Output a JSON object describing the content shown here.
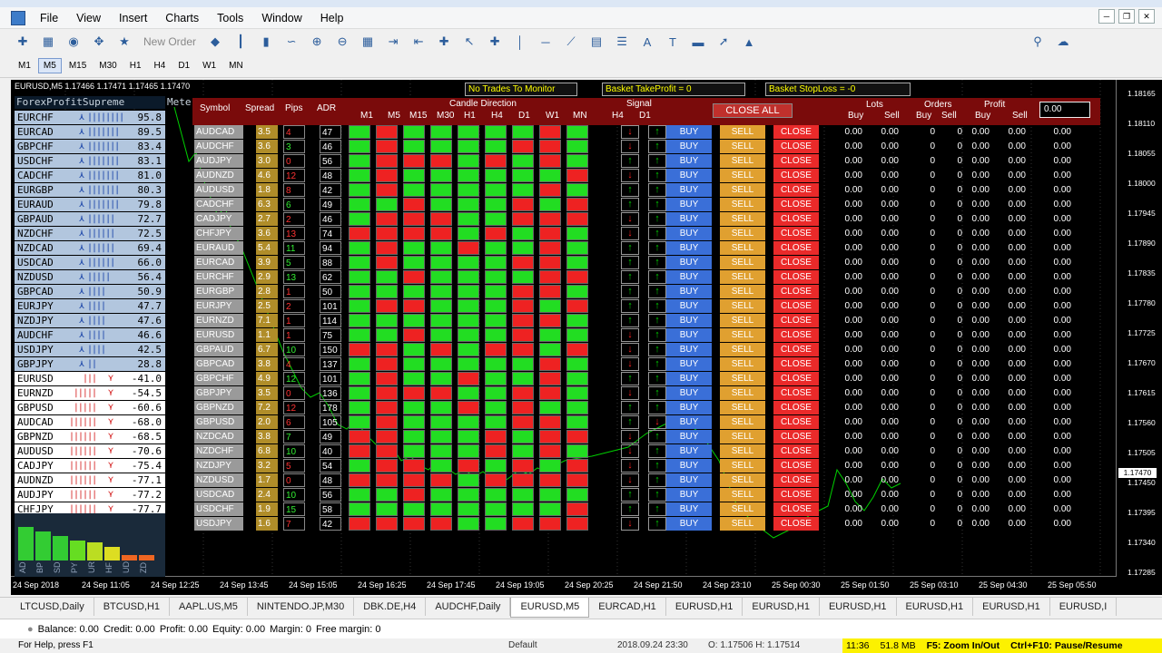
{
  "menu": [
    "File",
    "View",
    "Insert",
    "Charts",
    "Tools",
    "Window",
    "Help"
  ],
  "toolbar": {
    "new_order": "New Order"
  },
  "timeframes": [
    "M1",
    "M5",
    "M15",
    "M30",
    "H1",
    "H4",
    "D1",
    "W1",
    "MN"
  ],
  "active_timeframe": "M5",
  "chart": {
    "symbol_line": "EURUSD,M5  1.17466 1.17471 1.17465 1.17470",
    "current_price": "1.17470",
    "y_ticks": [
      "1.18165",
      "1.18110",
      "1.18055",
      "1.18000",
      "1.17945",
      "1.17890",
      "1.17835",
      "1.17780",
      "1.17725",
      "1.17670",
      "1.17615",
      "1.17560",
      "1.17505",
      "1.17450",
      "1.17395",
      "1.17340",
      "1.17285"
    ],
    "x_ticks": [
      "24 Sep 2018",
      "24 Sep 11:05",
      "24 Sep 12:25",
      "24 Sep 13:45",
      "24 Sep 15:05",
      "24 Sep 16:25",
      "24 Sep 17:45",
      "24 Sep 19:05",
      "24 Sep 20:25",
      "24 Sep 21:50",
      "24 Sep 23:10",
      "25 Sep 00:30",
      "25 Sep 01:50",
      "25 Sep 03:10",
      "25 Sep 04:30",
      "25 Sep 05:50"
    ]
  },
  "meter": {
    "title": "ForexProfitSupreme",
    "title2": "Meter",
    "rows": [
      {
        "pair": "EURCHF",
        "dir": "up",
        "value": "95.8"
      },
      {
        "pair": "EURCAD",
        "dir": "up",
        "value": "89.5"
      },
      {
        "pair": "GBPCHF",
        "dir": "up",
        "value": "83.4"
      },
      {
        "pair": "USDCHF",
        "dir": "up",
        "value": "83.1"
      },
      {
        "pair": "CADCHF",
        "dir": "up",
        "value": "81.0"
      },
      {
        "pair": "EURGBP",
        "dir": "up",
        "value": "80.3"
      },
      {
        "pair": "EURAUD",
        "dir": "up",
        "value": "79.8"
      },
      {
        "pair": "GBPAUD",
        "dir": "up",
        "value": "72.7"
      },
      {
        "pair": "NZDCHF",
        "dir": "up",
        "value": "72.5"
      },
      {
        "pair": "NZDCAD",
        "dir": "up",
        "value": "69.4"
      },
      {
        "pair": "USDCAD",
        "dir": "up",
        "value": "66.0"
      },
      {
        "pair": "NZDUSD",
        "dir": "up",
        "value": "56.4"
      },
      {
        "pair": "GBPCAD",
        "dir": "up",
        "value": "50.9"
      },
      {
        "pair": "EURJPY",
        "dir": "up",
        "value": "47.7"
      },
      {
        "pair": "NZDJPY",
        "dir": "up",
        "value": "47.6"
      },
      {
        "pair": "AUDCHF",
        "dir": "up",
        "value": "46.6"
      },
      {
        "pair": "USDJPY",
        "dir": "up",
        "value": "42.5"
      },
      {
        "pair": "GBPJPY",
        "dir": "up",
        "value": "28.8"
      },
      {
        "pair": "EURUSD",
        "dir": "dn",
        "value": "-41.0"
      },
      {
        "pair": "EURNZD",
        "dir": "dn",
        "value": "-54.5"
      },
      {
        "pair": "GBPUSD",
        "dir": "dn",
        "value": "-60.6"
      },
      {
        "pair": "AUDCAD",
        "dir": "dn",
        "value": "-68.0"
      },
      {
        "pair": "GBPNZD",
        "dir": "dn",
        "value": "-68.5"
      },
      {
        "pair": "AUDUSD",
        "dir": "dn",
        "value": "-70.6"
      },
      {
        "pair": "CADJPY",
        "dir": "dn",
        "value": "-75.4"
      },
      {
        "pair": "AUDNZD",
        "dir": "dn",
        "value": "-77.1"
      },
      {
        "pair": "AUDJPY",
        "dir": "dn",
        "value": "-77.2"
      },
      {
        "pair": "CHFJPY",
        "dir": "dn",
        "value": "-77.7"
      }
    ],
    "currencies": [
      "AD",
      "BP",
      "SD",
      "PY",
      "UR",
      "HF",
      "UD",
      "ZD"
    ],
    "currency_levels": [
      0.75,
      0.65,
      0.55,
      0.45,
      0.4,
      0.3,
      0.12,
      0.12
    ]
  },
  "dashboard": {
    "tickers": {
      "no_trades": "No Trades To Monitor",
      "basket_tp": "Basket TakeProfit = 0",
      "basket_sl": "Basket StopLoss = -0"
    },
    "close_all": "CLOSE ALL",
    "input_value": "0.00",
    "headers": {
      "symbol": "Symbol",
      "spread": "Spread",
      "pips": "Pips",
      "adr": "ADR",
      "candle": "Candle Direction",
      "signal": "Signal",
      "lots": "Lots",
      "orders": "Orders",
      "profit": "Profit",
      "buy": "Buy",
      "sell": "Sell"
    },
    "buy_label": "BUY",
    "sell_label": "SELL",
    "close_label": "CLOSE",
    "zero": "0.00",
    "zero_int": "0",
    "rows": [
      {
        "sym": "AUDCAD",
        "spread": "3.5",
        "pips": "4",
        "adr": "47",
        "pips_color": "r",
        "cd": "grgggggrgg",
        "h4": "d",
        "d1": "u"
      },
      {
        "sym": "AUDCHF",
        "spread": "3.6",
        "pips": "3",
        "adr": "46",
        "pips_color": "g",
        "cd": "grggggrrgg",
        "h4": "d",
        "d1": "u"
      },
      {
        "sym": "AUDJPY",
        "spread": "3.0",
        "pips": "0",
        "adr": "56",
        "pips_color": "r",
        "cd": "grrrgrgrgg",
        "h4": "u",
        "d1": "u"
      },
      {
        "sym": "AUDNZD",
        "spread": "4.6",
        "pips": "12",
        "adr": "48",
        "pips_color": "r",
        "cd": "grggggggrg",
        "h4": "d",
        "d1": "u"
      },
      {
        "sym": "AUDUSD",
        "spread": "1.8",
        "pips": "8",
        "adr": "42",
        "pips_color": "r",
        "cd": "grgggggrgg",
        "h4": "u",
        "d1": "u"
      },
      {
        "sym": "CADCHF",
        "spread": "6.3",
        "pips": "6",
        "adr": "49",
        "pips_color": "g",
        "cd": "ggrgggrgrg",
        "h4": "u",
        "d1": "u"
      },
      {
        "sym": "CADJPY",
        "spread": "2.7",
        "pips": "2",
        "adr": "46",
        "pips_color": "r",
        "cd": "grrrggrrrg",
        "h4": "d",
        "d1": "u"
      },
      {
        "sym": "CHFJPY",
        "spread": "3.6",
        "pips": "13",
        "adr": "74",
        "pips_color": "r",
        "cd": "rrrrgrgrgg",
        "h4": "d",
        "d1": "u"
      },
      {
        "sym": "EURAUD",
        "spread": "5.4",
        "pips": "11",
        "adr": "94",
        "pips_color": "g",
        "cd": "grggrggrgg",
        "h4": "u",
        "d1": "u"
      },
      {
        "sym": "EURCAD",
        "spread": "3.9",
        "pips": "5",
        "adr": "88",
        "pips_color": "g",
        "cd": "grggggrrgg",
        "h4": "u",
        "d1": "u"
      },
      {
        "sym": "EURCHF",
        "spread": "2.9",
        "pips": "13",
        "adr": "62",
        "pips_color": "g",
        "cd": "ggrggggrrg",
        "h4": "u",
        "d1": "u"
      },
      {
        "sym": "EURGBP",
        "spread": "2.8",
        "pips": "1",
        "adr": "50",
        "pips_color": "r",
        "cd": "ggggggrrgg",
        "h4": "u",
        "d1": "u"
      },
      {
        "sym": "EURJPY",
        "spread": "2.5",
        "pips": "2",
        "adr": "101",
        "pips_color": "r",
        "cd": "grrgggrgrg",
        "h4": "u",
        "d1": "u"
      },
      {
        "sym": "EURNZD",
        "spread": "7.1",
        "pips": "1",
        "adr": "114",
        "pips_color": "r",
        "cd": "ggggggrrgg",
        "h4": "u",
        "d1": "u"
      },
      {
        "sym": "EURUSD",
        "spread": "1.1",
        "pips": "1",
        "adr": "75",
        "pips_color": "r",
        "cd": "ggrgggrggg",
        "h4": "d",
        "d1": "u"
      },
      {
        "sym": "GBPAUD",
        "spread": "6.7",
        "pips": "10",
        "adr": "150",
        "pips_color": "g",
        "cd": "rrgrgrrgrg",
        "h4": "d",
        "d1": "u"
      },
      {
        "sym": "GBPCAD",
        "spread": "3.8",
        "pips": "4",
        "adr": "137",
        "pips_color": "r",
        "cd": "grgggggrgg",
        "h4": "d",
        "d1": "u"
      },
      {
        "sym": "GBPCHF",
        "spread": "4.9",
        "pips": "12",
        "adr": "101",
        "pips_color": "g",
        "cd": "grggrggrgg",
        "h4": "u",
        "d1": "u"
      },
      {
        "sym": "GBPJPY",
        "spread": "3.5",
        "pips": "0",
        "adr": "136",
        "pips_color": "r",
        "cd": "grrrggrrgg",
        "h4": "d",
        "d1": "u"
      },
      {
        "sym": "GBPNZD",
        "spread": "7.2",
        "pips": "12",
        "adr": "178",
        "pips_color": "r",
        "cd": "grggrgrggg",
        "h4": "u",
        "d1": "u"
      },
      {
        "sym": "GBPUSD",
        "spread": "2.0",
        "pips": "6",
        "adr": "105",
        "pips_color": "r",
        "cd": "grggggrrgg",
        "h4": "u",
        "d1": "d"
      },
      {
        "sym": "NZDCAD",
        "spread": "3.8",
        "pips": "7",
        "adr": "49",
        "pips_color": "g",
        "cd": "rrgggrgrrr",
        "h4": "d",
        "d1": "u"
      },
      {
        "sym": "NZDCHF",
        "spread": "6.8",
        "pips": "10",
        "adr": "40",
        "pips_color": "g",
        "cd": "rrgggrgrgr",
        "h4": "d",
        "d1": "u"
      },
      {
        "sym": "NZDJPY",
        "spread": "3.2",
        "pips": "5",
        "adr": "54",
        "pips_color": "r",
        "cd": "grrgrgrgrg",
        "h4": "d",
        "d1": "u"
      },
      {
        "sym": "NZDUSD",
        "spread": "1.7",
        "pips": "0",
        "adr": "48",
        "pips_color": "r",
        "cd": "rrrrgrrrrr",
        "h4": "d",
        "d1": "u"
      },
      {
        "sym": "USDCAD",
        "spread": "2.4",
        "pips": "10",
        "adr": "56",
        "pips_color": "g",
        "cd": "ggrggggggg",
        "h4": "u",
        "d1": "u"
      },
      {
        "sym": "USDCHF",
        "spread": "1.9",
        "pips": "15",
        "adr": "58",
        "pips_color": "g",
        "cd": "ggggggggrg",
        "h4": "u",
        "d1": "u"
      },
      {
        "sym": "USDJPY",
        "spread": "1.6",
        "pips": "7",
        "adr": "42",
        "pips_color": "r",
        "cd": "rrrrggrrrr",
        "h4": "d",
        "d1": "u"
      }
    ]
  },
  "tabs": [
    "LTCUSD,Daily",
    "BTCUSD,H1",
    "AAPL.US,M5",
    "NINTENDO.JP,M30",
    "DBK.DE,H4",
    "AUDCHF,Daily",
    "EURUSD,M5",
    "EURCAD,H1",
    "EURUSD,H1",
    "EURUSD,H1",
    "EURUSD,H1",
    "EURUSD,H1",
    "EURUSD,H1",
    "EURUSD,I"
  ],
  "active_tab": 6,
  "terminal": {
    "balance": "Balance: 0.00",
    "credit": "Credit: 0.00",
    "profit": "Profit: 0.00",
    "equity": "Equity: 0.00",
    "margin": "Margin: 0",
    "free_margin": "Free margin: 0"
  },
  "status": {
    "hint": "For Help, press F1",
    "default": "Default",
    "datetime": "2018.09.24 23:30",
    "ohlc": "O: 1.17506   H: 1.17514",
    "time": "11:36",
    "mem": "51.8 MB",
    "f5": "F5: Zoom In/Out",
    "ctrlf10": "Ctrl+F10: Pause/Resume"
  }
}
